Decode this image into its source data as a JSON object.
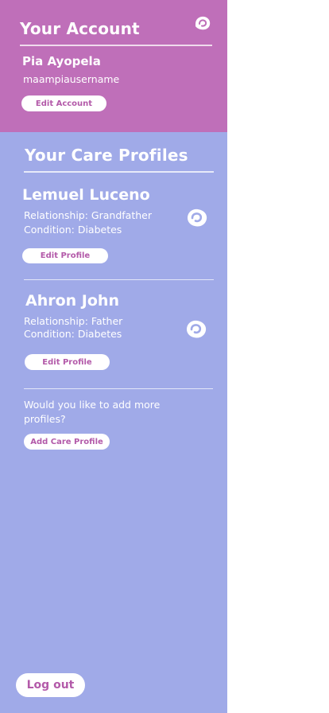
{
  "account": {
    "title": "Your Account",
    "name": "Pia Ayopela",
    "username": "maampiausername",
    "edit_label": "Edit Account"
  },
  "care": {
    "title": "Your Care Profiles",
    "profiles": [
      {
        "name": "Lemuel Luceno",
        "relationship": "Relationship: Grandfather",
        "condition": "Condition: Diabetes",
        "edit_label": "Edit Profile"
      },
      {
        "name": "Ahron John",
        "relationship": "Relationship: Father",
        "condition": "Condition: Diabetes",
        "edit_label": "Edit Profile"
      }
    ],
    "add_prompt": "Would you like to add more profiles?",
    "add_label": "Add Care Profile"
  },
  "logout_label": "Log out",
  "colors": {
    "account_bg": "#bf6fb9",
    "drawer_bg": "#a0aae8",
    "accent_text": "#b35aa9"
  },
  "icons": {
    "app_logo": "heart-drop-logo-icon",
    "profile": "heart-drop-icon"
  }
}
